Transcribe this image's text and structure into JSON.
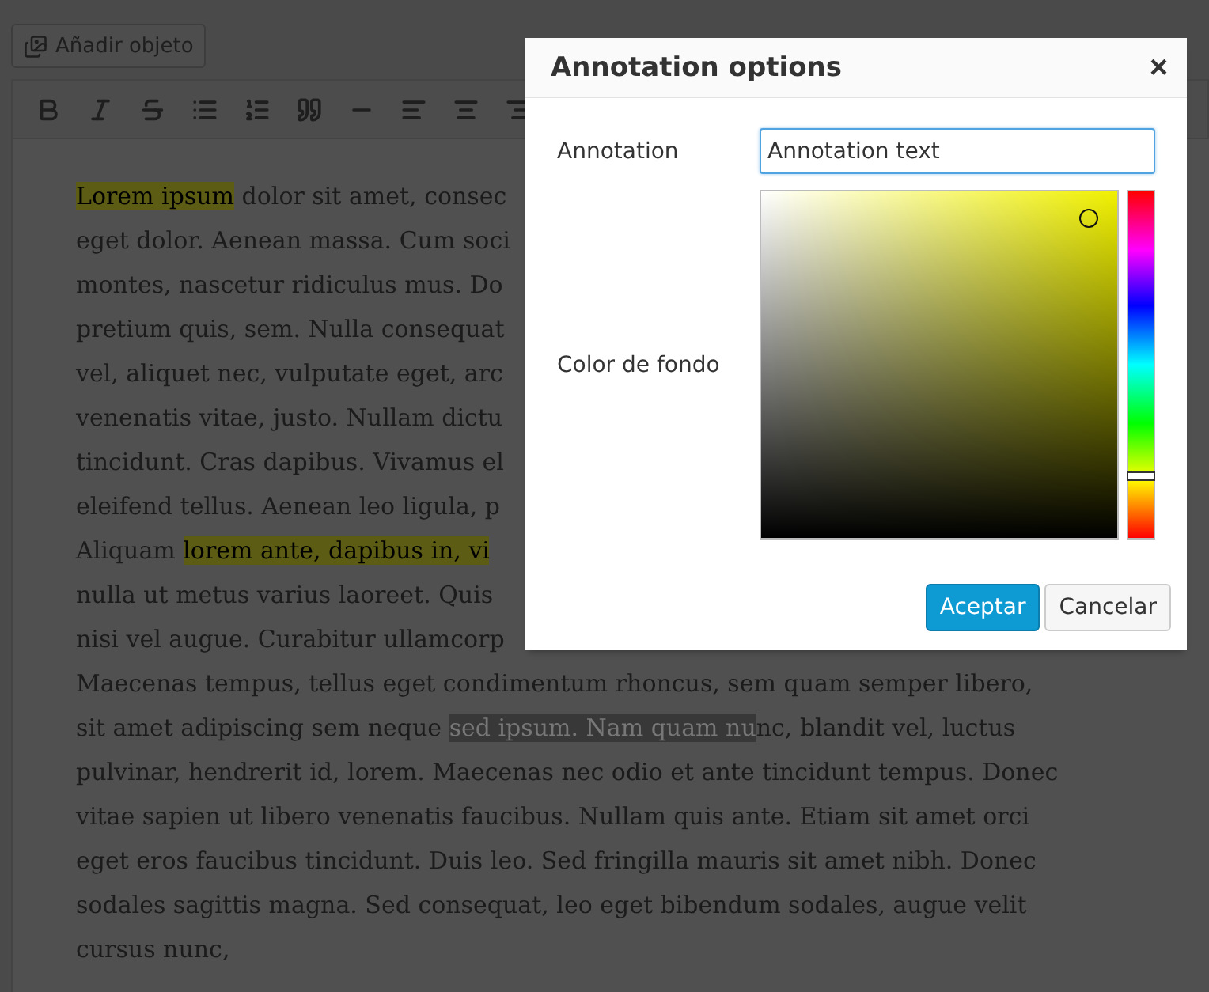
{
  "editor": {
    "add_media_button": "Añadir objeto",
    "toolbar": [
      {
        "kind": "bold"
      },
      {
        "kind": "italic"
      },
      {
        "kind": "strikethrough"
      },
      {
        "kind": "bullet-list"
      },
      {
        "kind": "numbered-list"
      },
      {
        "kind": "quote"
      },
      {
        "kind": "horizontal-rule"
      },
      {
        "kind": "align-left"
      },
      {
        "kind": "align-center"
      },
      {
        "kind": "align-right"
      }
    ],
    "lines": [
      [
        {
          "text": "Lorem ipsum",
          "kind": "annotation"
        },
        {
          "text": " dolor sit amet, consec",
          "kind": "plain"
        }
      ],
      [
        {
          "text": "eget dolor. Aenean massa. Cum soci",
          "kind": "plain"
        }
      ],
      [
        {
          "text": "montes, nascetur ridiculus mus. Do",
          "kind": "plain"
        }
      ],
      [
        {
          "text": "pretium quis, sem. Nulla consequat",
          "kind": "plain"
        }
      ],
      [
        {
          "text": "vel, aliquet nec, vulputate eget, arc",
          "kind": "plain"
        }
      ],
      [
        {
          "text": "venenatis vitae, justo. Nullam dictu",
          "kind": "plain"
        }
      ],
      [
        {
          "text": "tincidunt. Cras dapibus. Vivamus el",
          "kind": "plain"
        }
      ],
      [
        {
          "text": "eleifend tellus. Aenean leo ligula, p",
          "kind": "plain"
        }
      ],
      [
        {
          "text": "Aliquam ",
          "kind": "plain"
        },
        {
          "text": "lorem ante, dapibus in, vi",
          "kind": "annotation"
        }
      ],
      [
        {
          "text": "nulla ut metus varius laoreet. Quis",
          "kind": "plain"
        }
      ],
      [
        {
          "text": "nisi vel augue. Curabitur ullamcorp",
          "kind": "plain"
        }
      ],
      [
        {
          "text": "Maecenas tempus, tellus eget condimentum rhoncus, sem quam semper libero,",
          "kind": "plain"
        }
      ],
      [
        {
          "text": "sit amet adipiscing sem neque ",
          "kind": "plain"
        },
        {
          "text": "sed ipsum. Nam quam nu",
          "kind": "selection"
        },
        {
          "text": "nc, blandit vel, luctus",
          "kind": "plain"
        }
      ],
      [
        {
          "text": "pulvinar, hendrerit id, lorem. Maecenas nec odio et ante tincidunt tempus. Donec",
          "kind": "plain"
        }
      ],
      [
        {
          "text": "vitae sapien ut libero venenatis faucibus. Nullam quis ante. Etiam sit amet orci",
          "kind": "plain"
        }
      ],
      [
        {
          "text": "eget eros faucibus tincidunt. Duis leo. Sed fringilla mauris sit amet nibh. Donec",
          "kind": "plain"
        }
      ],
      [
        {
          "text": "sodales sagittis magna. Sed consequat, leo eget bibendum sodales, augue velit",
          "kind": "plain"
        }
      ],
      [
        {
          "text": "cursus nunc,",
          "kind": "plain"
        }
      ]
    ]
  },
  "dialog": {
    "title": "Annotation options",
    "close": "×",
    "annotation_label": "Annotation",
    "annotation_value": "Annotation text",
    "color_label": "Color de fondo",
    "hue_slider": {
      "level": 0.18
    },
    "buttons": [
      {
        "label": "Aceptar",
        "kind": "primary"
      },
      {
        "label": "Cancelar",
        "kind": "secondary"
      }
    ]
  }
}
